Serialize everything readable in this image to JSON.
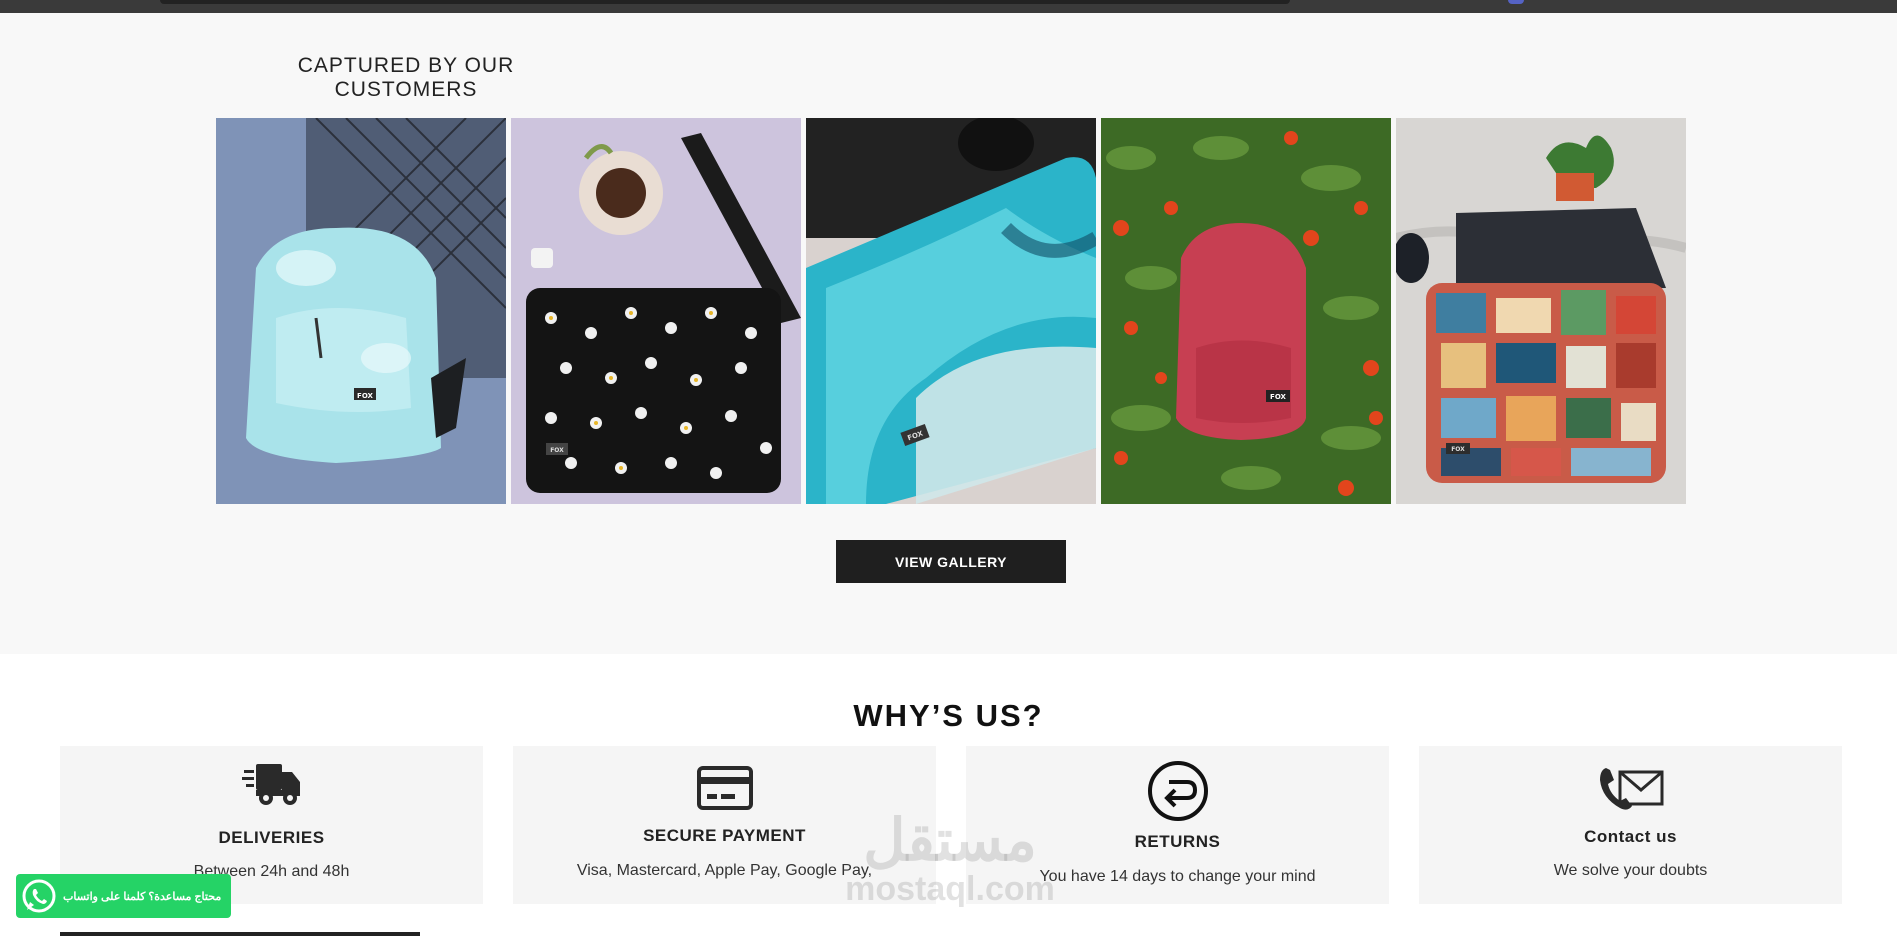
{
  "gallery": {
    "title": "CAPTURED BY OUR CUSTOMERS",
    "button_label": "VIEW GALLERY",
    "photos": [
      {
        "name": "photo-tie-dye-backpack",
        "brand": "FOX"
      },
      {
        "name": "photo-daisy-laptop-sleeve",
        "brand": "FOX"
      },
      {
        "name": "photo-marble-laptop-sleeve",
        "brand": "FOX"
      },
      {
        "name": "photo-red-backpack",
        "brand": "FOX"
      },
      {
        "name": "photo-sticker-laptop-sleeve",
        "brand": "FOX"
      }
    ]
  },
  "why_us": {
    "title": "WHY’S US?",
    "cards": [
      {
        "icon": "delivery-truck-icon",
        "title": "DELIVERIES",
        "text": "Between 24h and 48h"
      },
      {
        "icon": "credit-card-icon",
        "title": "SECURE PAYMENT",
        "text": "Visa, Mastercard, Apple Pay, Google Pay,"
      },
      {
        "icon": "returns-icon",
        "title": "RETURNS",
        "text": "You have 14 days to change your mind"
      },
      {
        "icon": "phone-mail-icon",
        "title": "Contact us",
        "text": "We solve your doubts"
      }
    ]
  },
  "whatsapp": {
    "label": "محتاج مساعدة؟ كلمنا على واتساب",
    "color": "#25d366"
  },
  "watermark": {
    "arabic": "مستقل",
    "latin": "mostaql.com"
  },
  "colors": {
    "button_bg": "#1f1f1f",
    "page_bg": "#f8f8f8",
    "card_bg": "#f5f5f5"
  }
}
